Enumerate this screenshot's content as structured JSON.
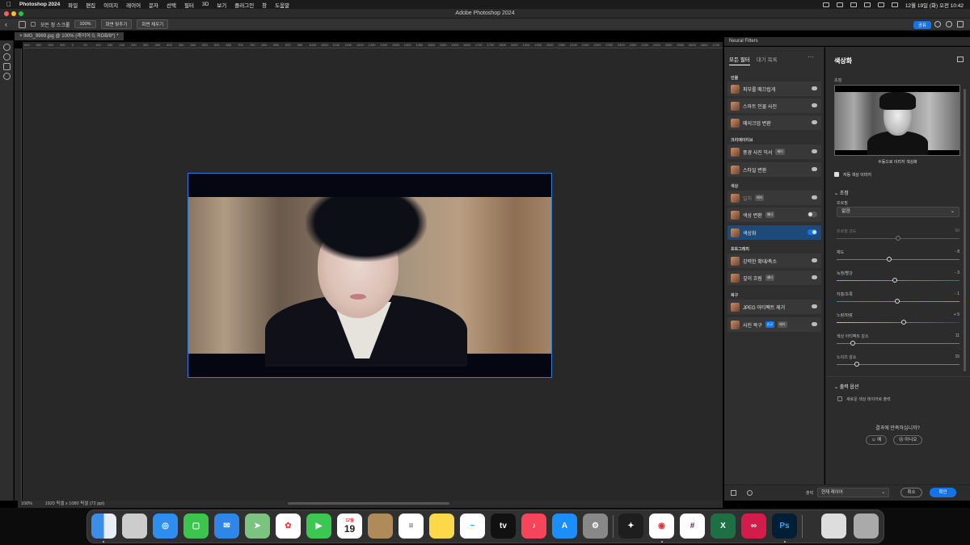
{
  "menubar": {
    "app_name": "Photoshop 2024",
    "items": [
      "파일",
      "편집",
      "이미지",
      "레이어",
      "문자",
      "선택",
      "필터",
      "3D",
      "보기",
      "플러그인",
      "창",
      "도움말"
    ],
    "clock": "12월 19일 (화) 오전 10:42"
  },
  "window": {
    "title": "Adobe Photoshop 2024"
  },
  "options_bar": {
    "scroll_all_label": "모든 창 스크롤",
    "zoom_value": "100%",
    "fit_screen": "화면 맞추기",
    "fill_screen": "화면 채우기",
    "share": "공유"
  },
  "document": {
    "tab": "IMG_9969.jpg @ 100% (레이어 0, RGB/8*) *",
    "zoom": "100%",
    "info": "1920 픽셀 x 1080 픽셀 (72 ppi)",
    "ruler_ticks": [
      "800",
      "850",
      "900",
      "950",
      "0",
      "50",
      "100",
      "150",
      "200",
      "250",
      "300",
      "350",
      "400",
      "450",
      "500",
      "550",
      "600",
      "650",
      "700",
      "750",
      "800",
      "850",
      "900",
      "950",
      "1000",
      "1050",
      "1100",
      "1150",
      "1200",
      "1250",
      "1300",
      "1350",
      "1400",
      "1450",
      "1500",
      "1550",
      "1600",
      "1650",
      "1700",
      "1750",
      "1800",
      "1850",
      "1900",
      "1950",
      "2000",
      "2050",
      "2100",
      "2150",
      "2200",
      "2250",
      "2300",
      "2350",
      "2400",
      "2450",
      "2500",
      "2550",
      "2600",
      "2650",
      "2700"
    ]
  },
  "neural_filters": {
    "panel_title": "Neural Filters",
    "tab_all": "모든 필터",
    "tab_waitlist": "대기 목록",
    "more": "···",
    "categories": {
      "portrait": "인물",
      "creative": "크리에이티브",
      "color": "색상",
      "photography": "포토그래피",
      "restore": "복구"
    },
    "filters": {
      "smooth_skin": "피부를 매끄럽게",
      "smart_portrait": "스마트 인물 사진",
      "makeup_transfer": "메이크업 변환",
      "landscape_mixer": "풍경 사진 믹서",
      "style_transfer": "스타일 변환",
      "harmonization": "일치",
      "color_transfer": "색상 변환",
      "colorize": "색상화",
      "super_zoom": "강력한 확대/축소",
      "depth_blur": "깊이 흐림",
      "jpeg_removal": "JPEG 아티팩트 제거",
      "photo_restoration": "사진 복구"
    },
    "beta": "베타",
    "new": "신규"
  },
  "settings": {
    "title": "색상화",
    "focus_label": "초점",
    "preview_caption": "수동으로 이미지 색상화",
    "auto_color_label": "자동 색상 이미지",
    "adjust_section": "조정",
    "profile_label": "프로필",
    "profile_value": "없음",
    "profile_strength_label": "프로필 강도",
    "profile_strength_value": "50",
    "saturation_label": "채도",
    "saturation_value": "- 8",
    "cyan_red_label": "녹청/빨강",
    "cyan_red_value": "- 3",
    "magenta_green_label": "자홍/초록",
    "magenta_green_value": "- 1",
    "yellow_blue_label": "노랑/파랑",
    "yellow_blue_value": "+ 5",
    "color_artifact_label": "색상 아티팩트 감소",
    "color_artifact_value": "11",
    "noise_label": "노이즈 감소",
    "noise_value": "15",
    "output_section": "출력 옵션",
    "new_color_layer": "새로운 색상 레이어로 출력",
    "satisfied_q": "결과에 만족하십니까?",
    "yes": "예",
    "no": "아니오"
  },
  "bottom": {
    "output_label": "출력",
    "output_value": "현재 레이어",
    "cancel": "취소",
    "ok": "확인"
  },
  "dock": {
    "calendar_month": "12월",
    "calendar_day": "19",
    "ps_label": "Ps",
    "tv_label": "tv"
  },
  "colors": {
    "accent": "#1473e6",
    "selection": "#2f7bd6"
  }
}
